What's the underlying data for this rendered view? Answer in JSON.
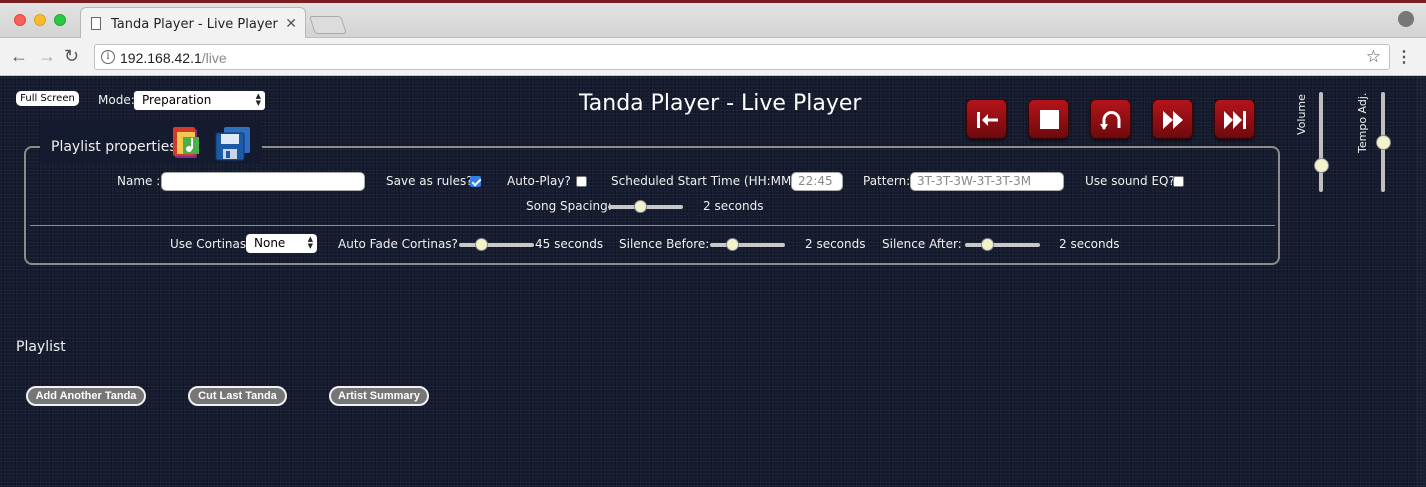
{
  "browser": {
    "tab_title": "Tanda Player - Live Player",
    "tab_close": "✕",
    "url_host": "192.168.42.1",
    "url_path": "/live",
    "info_glyph": "i",
    "back_glyph": "←",
    "forward_glyph": "→",
    "reload_glyph": "↻",
    "star_glyph": "☆",
    "menu_glyph": "⋮"
  },
  "header": {
    "fullscreen_label": "Full Screen",
    "mode_label": "Mode:",
    "mode_value": "Preparation",
    "title": "Tanda Player - Live Player"
  },
  "transport": {
    "buttons": [
      "restart",
      "stop",
      "repeat",
      "fast-forward",
      "next-track"
    ],
    "accent_color": "#a51218"
  },
  "levels": {
    "volume_label": "Volume",
    "tempo_label": "Tempo Adj.",
    "volume_fraction": 0.22,
    "tempo_fraction": 0.5
  },
  "properties": {
    "legend": "Playlist properties",
    "name_label": "Name :",
    "name_value": "",
    "save_rules_label": "Save as rules? :",
    "save_rules_checked": true,
    "autoplay_label": "Auto-Play? :",
    "autoplay_checked": false,
    "start_time_label": "Scheduled Start Time (HH:MM) :",
    "start_time_value": "22:45",
    "pattern_label": "Pattern:",
    "pattern_value": "3T-3T-3W-3T-3T-3M",
    "sound_eq_label": "Use sound EQ?",
    "sound_eq_checked": false,
    "song_spacing_label": "Song Spacing:",
    "song_spacing_value": "2 seconds",
    "song_spacing_fraction": 0.42,
    "cortinas_label": "Use Cortinas:",
    "cortinas_value": "None",
    "auto_fade_label": "Auto Fade Cortinas?",
    "auto_fade_value": "45 seconds",
    "auto_fade_fraction": 0.25,
    "silence_before_label": "Silence Before:",
    "silence_before_value": "2 seconds",
    "silence_before_fraction": 0.25,
    "silence_after_label": "Silence After:",
    "silence_after_value": "2 seconds",
    "silence_after_fraction": 0.25
  },
  "playlist": {
    "heading": "Playlist",
    "add_tanda_label": "Add Another Tanda",
    "cut_tanda_label": "Cut Last Tanda",
    "artist_summary_label": "Artist Summary"
  }
}
